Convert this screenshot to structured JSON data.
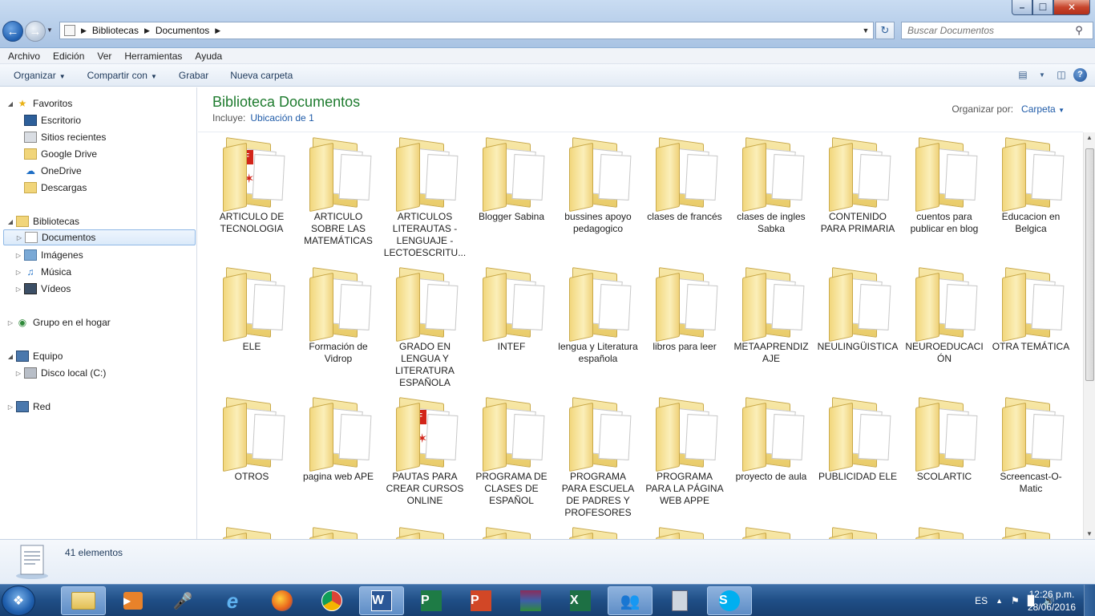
{
  "window": {
    "controls": {
      "minimize": "–",
      "maximize": "☐",
      "close": "✕"
    }
  },
  "address": {
    "crumbs": [
      "Bibliotecas",
      "Documentos"
    ],
    "search_placeholder": "Buscar Documentos"
  },
  "menu": [
    "Archivo",
    "Edición",
    "Ver",
    "Herramientas",
    "Ayuda"
  ],
  "commands": {
    "organize": "Organizar",
    "share": "Compartir con",
    "burn": "Grabar",
    "new_folder": "Nueva carpeta"
  },
  "nav": {
    "favorites": "Favoritos",
    "desktop": "Escritorio",
    "recent": "Sitios recientes",
    "gdrive": "Google Drive",
    "onedrive": "OneDrive",
    "downloads": "Descargas",
    "libraries": "Bibliotecas",
    "documents": "Documentos",
    "images": "Imágenes",
    "music": "Música",
    "videos": "Vídeos",
    "homegroup": "Grupo en el hogar",
    "computer": "Equipo",
    "localdisk": "Disco local (C:)",
    "network": "Red"
  },
  "library": {
    "title": "Biblioteca Documentos",
    "includes_label": "Incluye:",
    "includes_link": "Ubicación de 1",
    "arrange_label": "Organizar por:",
    "arrange_value": "Carpeta"
  },
  "folders": [
    {
      "label": "ARTICULO DE TECNOLOGIA",
      "pdf": true
    },
    {
      "label": "ARTICULO SOBRE LAS MATEMÁTICAS",
      "pdf": false
    },
    {
      "label": "ARTICULOS LITERAUTAS -LENGUAJE - LECTOESCRITU...",
      "pdf": false
    },
    {
      "label": "Blogger Sabina",
      "pdf": false
    },
    {
      "label": "bussines apoyo pedagogico",
      "pdf": false
    },
    {
      "label": "clases de francés",
      "pdf": false
    },
    {
      "label": "clases de ingles Sabka",
      "pdf": false
    },
    {
      "label": "CONTENIDO PARA PRIMARIA",
      "pdf": false
    },
    {
      "label": "cuentos para publicar en blog",
      "pdf": false
    },
    {
      "label": "Educacion en Belgica",
      "pdf": false
    },
    {
      "label": "ELE",
      "pdf": false
    },
    {
      "label": "Formación de Vidrop",
      "pdf": false
    },
    {
      "label": "GRADO EN LENGUA Y LITERATURA ESPAÑOLA",
      "pdf": false
    },
    {
      "label": "INTEF",
      "pdf": false
    },
    {
      "label": "lengua y Literatura española",
      "pdf": false
    },
    {
      "label": "libros para leer",
      "pdf": false
    },
    {
      "label": "METAAPRENDIZ AJE",
      "pdf": false
    },
    {
      "label": "NEULINGÜISTICA",
      "pdf": false
    },
    {
      "label": "NEUROEDUCACI ÓN",
      "pdf": false
    },
    {
      "label": "OTRA TEMÁTICA",
      "pdf": false
    },
    {
      "label": "OTROS",
      "pdf": false
    },
    {
      "label": "pagina web APE",
      "pdf": false
    },
    {
      "label": "PAUTAS PARA CREAR CURSOS ONLINE",
      "pdf": true
    },
    {
      "label": "PROGRAMA DE CLASES DE ESPAÑOL",
      "pdf": false
    },
    {
      "label": "PROGRAMA PARA ESCUELA DE PADRES Y PROFESORES",
      "pdf": false
    },
    {
      "label": "PROGRAMA PARA LA PÁGINA WEB APPE",
      "pdf": false
    },
    {
      "label": "proyecto de aula",
      "pdf": false
    },
    {
      "label": "PUBLICIDAD ELE",
      "pdf": false
    },
    {
      "label": "SCOLARTIC",
      "pdf": false
    },
    {
      "label": "Screencast-O-Matic",
      "pdf": false
    }
  ],
  "details": {
    "count": "41 elementos"
  },
  "taskbar": {
    "lang": "ES",
    "time": "12:26 p.m.",
    "date": "28/06/2016"
  },
  "colors": {
    "title_green": "#1e7b2e",
    "link_blue": "#1f5ba8"
  }
}
